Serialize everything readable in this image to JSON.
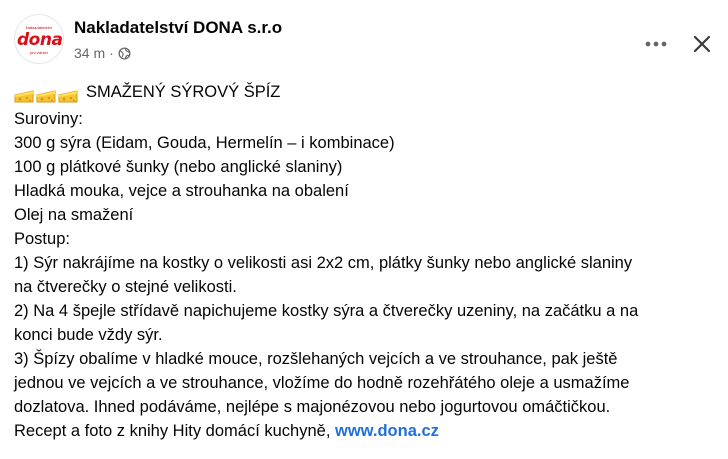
{
  "post": {
    "author": "Nakladatelství DONA s.r.o",
    "time": "34 m",
    "separator": "·",
    "avatar": {
      "logo_text": "dona",
      "small_text": "Nakladatelství",
      "tag_text": "pro zdraví"
    },
    "icons": {
      "privacy": "globe-icon",
      "more": "more-options-icon",
      "close": "close-icon",
      "emoji": "cheese-emoji"
    },
    "title": "SMAŽENÝ SÝROVÝ ŠPÍZ",
    "lines": [
      "Suroviny:",
      "300 g sýra (Eidam, Gouda, Hermelín – i kombinace)",
      "100 g plátkové šunky (nebo anglické slaniny)",
      "Hladká mouka, vejce a strouhanka na obalení",
      "Olej na smažení",
      "Postup:",
      "1) Sýr nakrájíme na kostky o velikosti asi 2x2 cm, plátky šunky nebo anglické slaniny",
      "na čtverečky o stejné velikosti.",
      "2) Na 4 špejle střídavě napichujeme kostky sýra a čtverečky uzeniny, na začátku a na",
      "konci bude vždy sýr.",
      "3) Špízy obalíme v hladké mouce, rozšlehaných vejcích a ve strouhance, pak ještě",
      "jednou ve vejcích a ve strouhance, vložíme do hodně rozehřátého oleje a usmažíme",
      "dozlatova. Ihned podáváme, nejlépe s majonézovou nebo jogurtovou omáčtičkou."
    ],
    "last_line_prefix": "Recept a foto z knihy Hity domácí kuchyně, ",
    "link_text": "www.dona.cz"
  },
  "colors": {
    "text": "#050505",
    "secondary": "#65676b",
    "link": "#216fdb",
    "brand": "#d8101a"
  }
}
